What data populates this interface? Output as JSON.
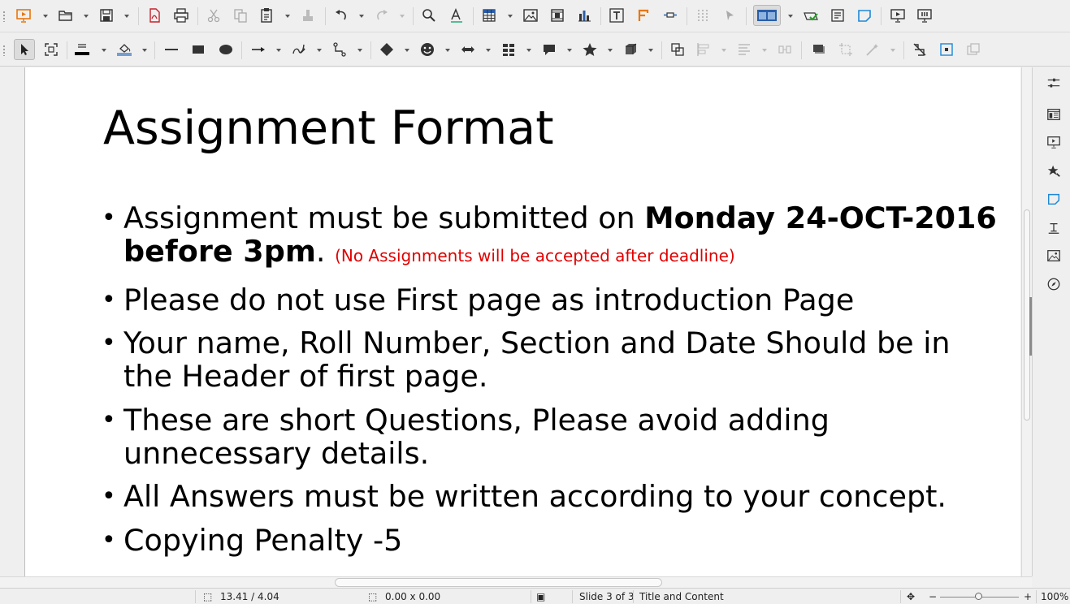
{
  "toolbar1": {
    "icons": [
      "slideshow-icon",
      "open-icon",
      "save-icon",
      "export-pdf-icon",
      "print-icon",
      "cut-icon",
      "copy-icon",
      "paste-icon",
      "clone-formatting-icon",
      "undo-icon",
      "redo-icon",
      "find-replace-icon",
      "spelling-icon",
      "table-icon",
      "image-icon",
      "media-icon",
      "chart-icon",
      "textbox-icon",
      "fontwork-icon",
      "fields-icon",
      "grid-icon",
      "helplines-icon",
      "display-views-icon",
      "master-slide-icon",
      "slide-layout-icon",
      "slide-properties-icon",
      "start-first-icon",
      "start-current-icon"
    ]
  },
  "toolbar2": {
    "icons": [
      "select-icon",
      "zoom-pan-icon",
      "line-color-icon",
      "fill-color-icon",
      "line-icon",
      "rectangle-icon",
      "ellipse-icon",
      "lines-arrows-icon",
      "curves-icon",
      "connectors-icon",
      "basic-shapes-icon",
      "symbol-shapes-icon",
      "block-arrows-icon",
      "flowchart-icon",
      "callouts-icon",
      "stars-icon",
      "3d-objects-icon",
      "transformations-icon",
      "align-icon",
      "arrange-icon",
      "distribute-icon",
      "shadow-icon",
      "crop-icon",
      "filter-icon",
      "toggle-extrusion-icon",
      "glue-points-icon",
      "show-draw-functions-icon"
    ],
    "line_color": "#000000",
    "fill_color": "#729fcf"
  },
  "slide": {
    "title": "Assignment Format",
    "bullets": [
      {
        "part1": "Assignment must be submitted on ",
        "bold": "Monday 24-OCT-2016 before 3pm",
        "part2": ". ",
        "note": "(No Assignments will be accepted after deadline)"
      },
      {
        "text": "Please do not use First page as introduction Page"
      },
      {
        "text": "Your name, Roll Number, Section and Date Should be in the Header of first page."
      },
      {
        "text": "These are short Questions, Please avoid adding unnecessary details."
      },
      {
        "text": "All Answers must be written according to your concept."
      },
      {
        "text": "Copying Penalty -5"
      }
    ],
    "note_color": "#e00000"
  },
  "sidebar": {
    "icons": [
      "properties-icon",
      "slide-transition-icon",
      "animation-icon",
      "styles-icon",
      "master-slides-icon",
      "gallery-icon",
      "navigator-icon"
    ]
  },
  "status": {
    "position": "13.41 / 4.04",
    "size": "0.00 x 0.00",
    "slide": "Slide 3 of 3",
    "layout": "Title and Content",
    "zoom": "100%"
  }
}
